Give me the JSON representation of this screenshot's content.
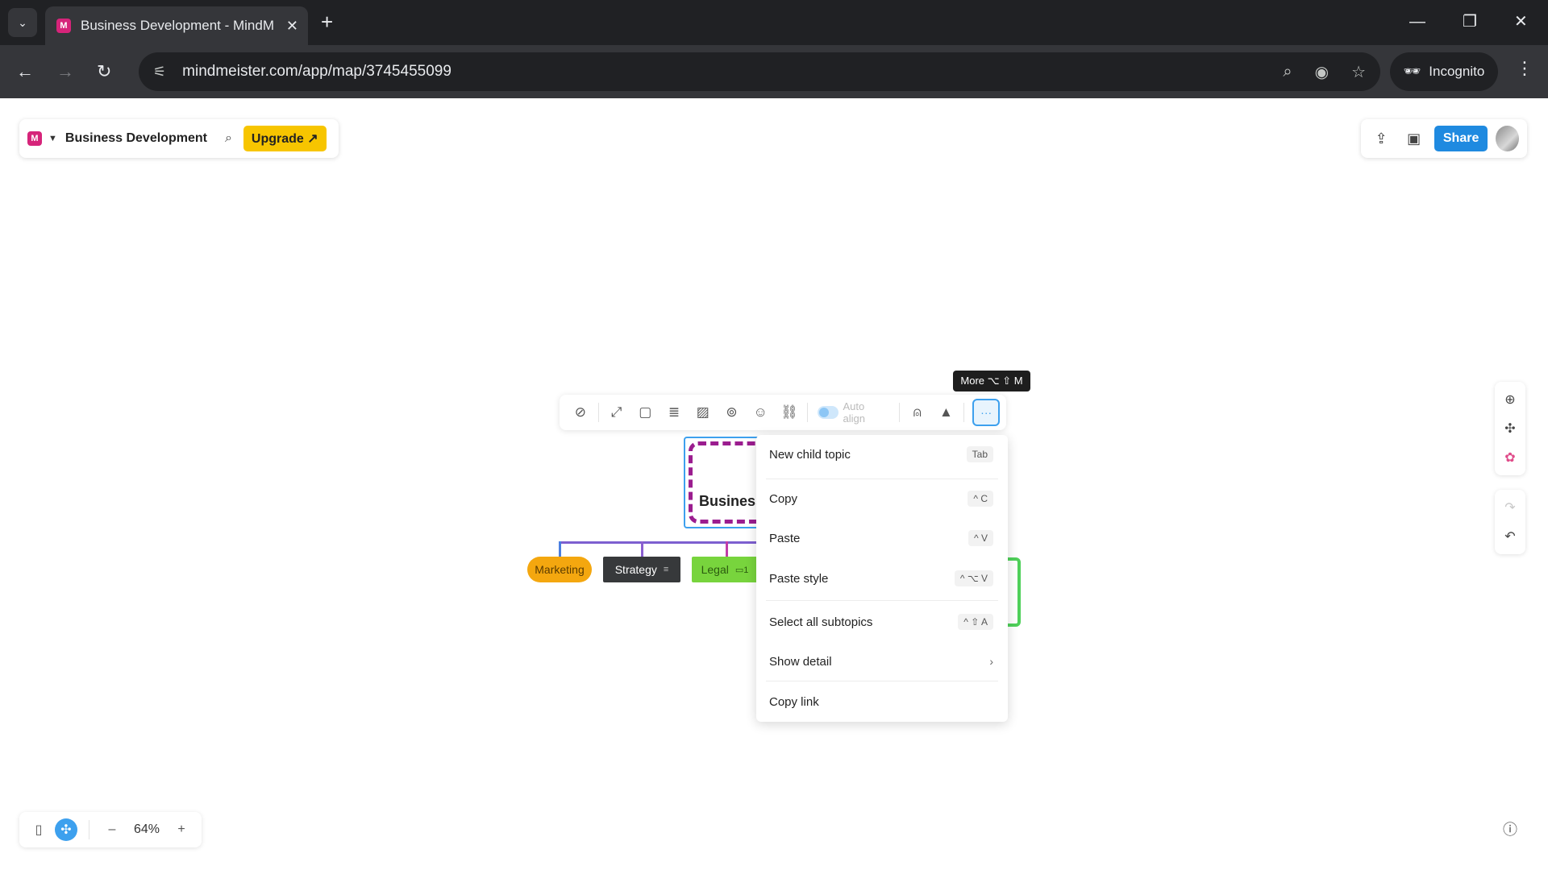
{
  "browser": {
    "tab_title": "Business Development - MindM",
    "tab_favicon": "M",
    "url": "mindmeister.com/app/map/3745455099",
    "incognito_label": "Incognito",
    "icons": [
      "tab-switch-icon",
      "close-icon",
      "new-tab-icon",
      "minimize-icon",
      "restore-icon",
      "window-close-icon",
      "back-icon",
      "forward-icon",
      "reload-icon",
      "site-info-icon",
      "zoom-icon",
      "tracking-protection-icon",
      "bookmark-star-icon",
      "incognito-icon",
      "browser-menu-icon"
    ]
  },
  "header": {
    "logo": "M",
    "map_title": "Business Development",
    "upgrade_label": "Upgrade ↗",
    "share_label": "Share"
  },
  "toolbar": {
    "auto_align_label": "Auto align",
    "more_label": "···",
    "tooltip": "More ⌥ ⇧ M"
  },
  "mindmap": {
    "root_label": "Business",
    "children": [
      {
        "label": "Marketing",
        "color": "#f4a70f"
      },
      {
        "label": "Strategy",
        "color": "#37393b"
      },
      {
        "label": "Legal",
        "color": "#78d43d",
        "badge": "1"
      }
    ],
    "root_border_color": "#9b1d8f"
  },
  "menu": {
    "items": [
      {
        "label": "New child topic",
        "shortcut": "Tab"
      },
      {
        "label": "Copy",
        "shortcut": "^ C"
      },
      {
        "label": "Paste",
        "shortcut": "^ V"
      },
      {
        "label": "Paste style",
        "shortcut": "^ ⌥ V"
      },
      {
        "label": "Select all subtopics",
        "shortcut": "^ ⇧ A"
      },
      {
        "label": "Show detail",
        "shortcut": "›"
      },
      {
        "label": "Copy link",
        "shortcut": ""
      }
    ]
  },
  "zoom": {
    "value": "64%",
    "minus": "–",
    "plus": "+"
  },
  "colors": {
    "accent": "#3da0ee",
    "upgrade": "#f7c500",
    "share": "#1f8ae0",
    "brand": "#d6247a"
  }
}
